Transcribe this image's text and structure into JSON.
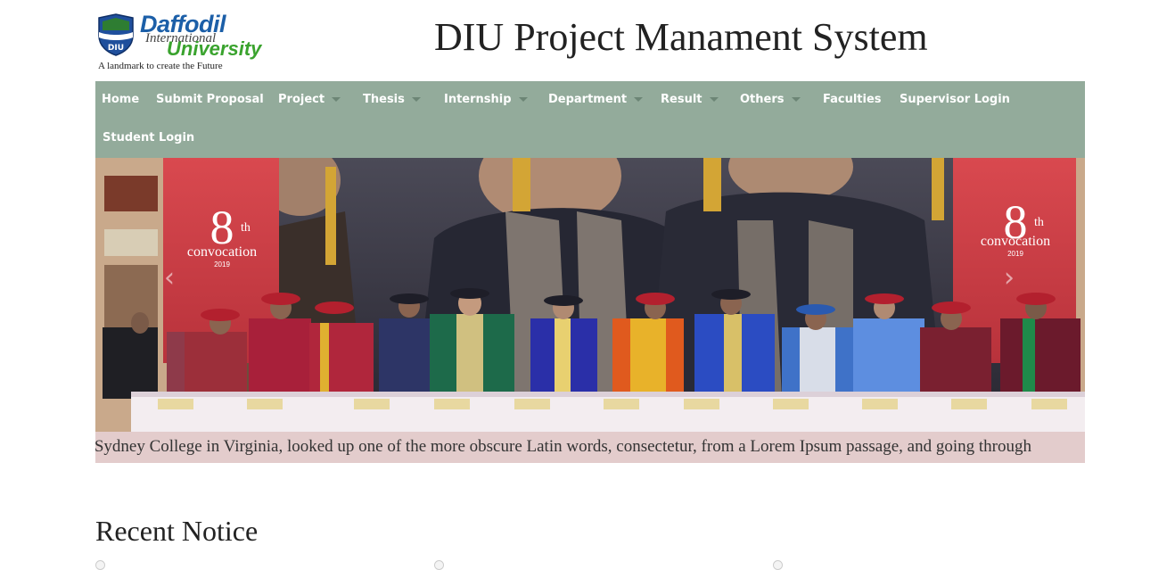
{
  "header": {
    "logo": {
      "name_line1": "Daffodil",
      "name_line2": "International",
      "name_line3": "University",
      "shield_text": "DIU",
      "tagline": "A landmark to create the Future"
    },
    "site_title": "DIU Project Manament System"
  },
  "nav": {
    "items": [
      {
        "label": "Home",
        "dropdown": false
      },
      {
        "label": "Submit Proposal",
        "dropdown": false
      },
      {
        "label": "Project",
        "dropdown": true
      },
      {
        "label": "Thesis",
        "dropdown": true
      },
      {
        "label": "Internship",
        "dropdown": true
      },
      {
        "label": "Department",
        "dropdown": true
      },
      {
        "label": "Result",
        "dropdown": true
      },
      {
        "label": "Others",
        "dropdown": true
      },
      {
        "label": "Faculties",
        "dropdown": false
      },
      {
        "label": "Supervisor Login",
        "dropdown": false
      },
      {
        "label": "Student Login",
        "dropdown": false
      }
    ],
    "background": "#93ab9b"
  },
  "slider": {
    "banner_text_number": "8",
    "banner_text_suffix": "th",
    "banner_text_label": "convocation",
    "banner_text_year": "2019",
    "prev_icon": "chevron-left-icon",
    "next_icon": "chevron-right-icon"
  },
  "marquee": {
    "text": "n-Sydney College in Virginia, looked up one of the more obscure Latin words, consectetur, from a Lorem Ipsum passage, and going through",
    "background": "#e3cccc"
  },
  "recent_notice": {
    "title": "Recent Notice"
  }
}
